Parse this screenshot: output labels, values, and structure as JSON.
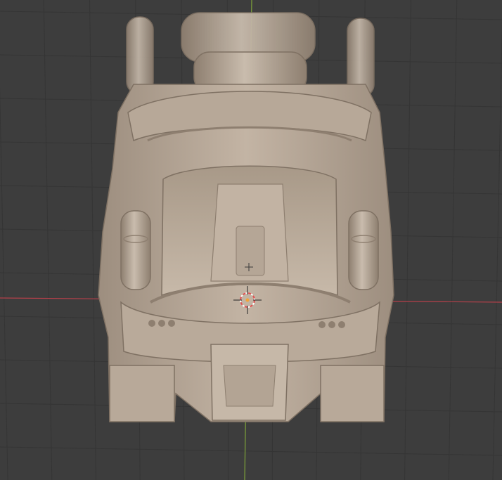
{
  "viewport": {
    "view": "top-orthographic",
    "background_color": "#3d3d3d",
    "grid_color": "#353535",
    "x_axis_color": "#b5404a",
    "y_axis_color": "#7ea33a"
  },
  "model": {
    "subject": "armored-buggy-vehicle",
    "material_color": "#b4a595",
    "shadow_color": "#8e7f70",
    "highlight_color": "#d6c9ba"
  },
  "cursor": {
    "icon": "3d-cursor-icon"
  },
  "origin": {
    "icon": "object-origin-icon"
  }
}
